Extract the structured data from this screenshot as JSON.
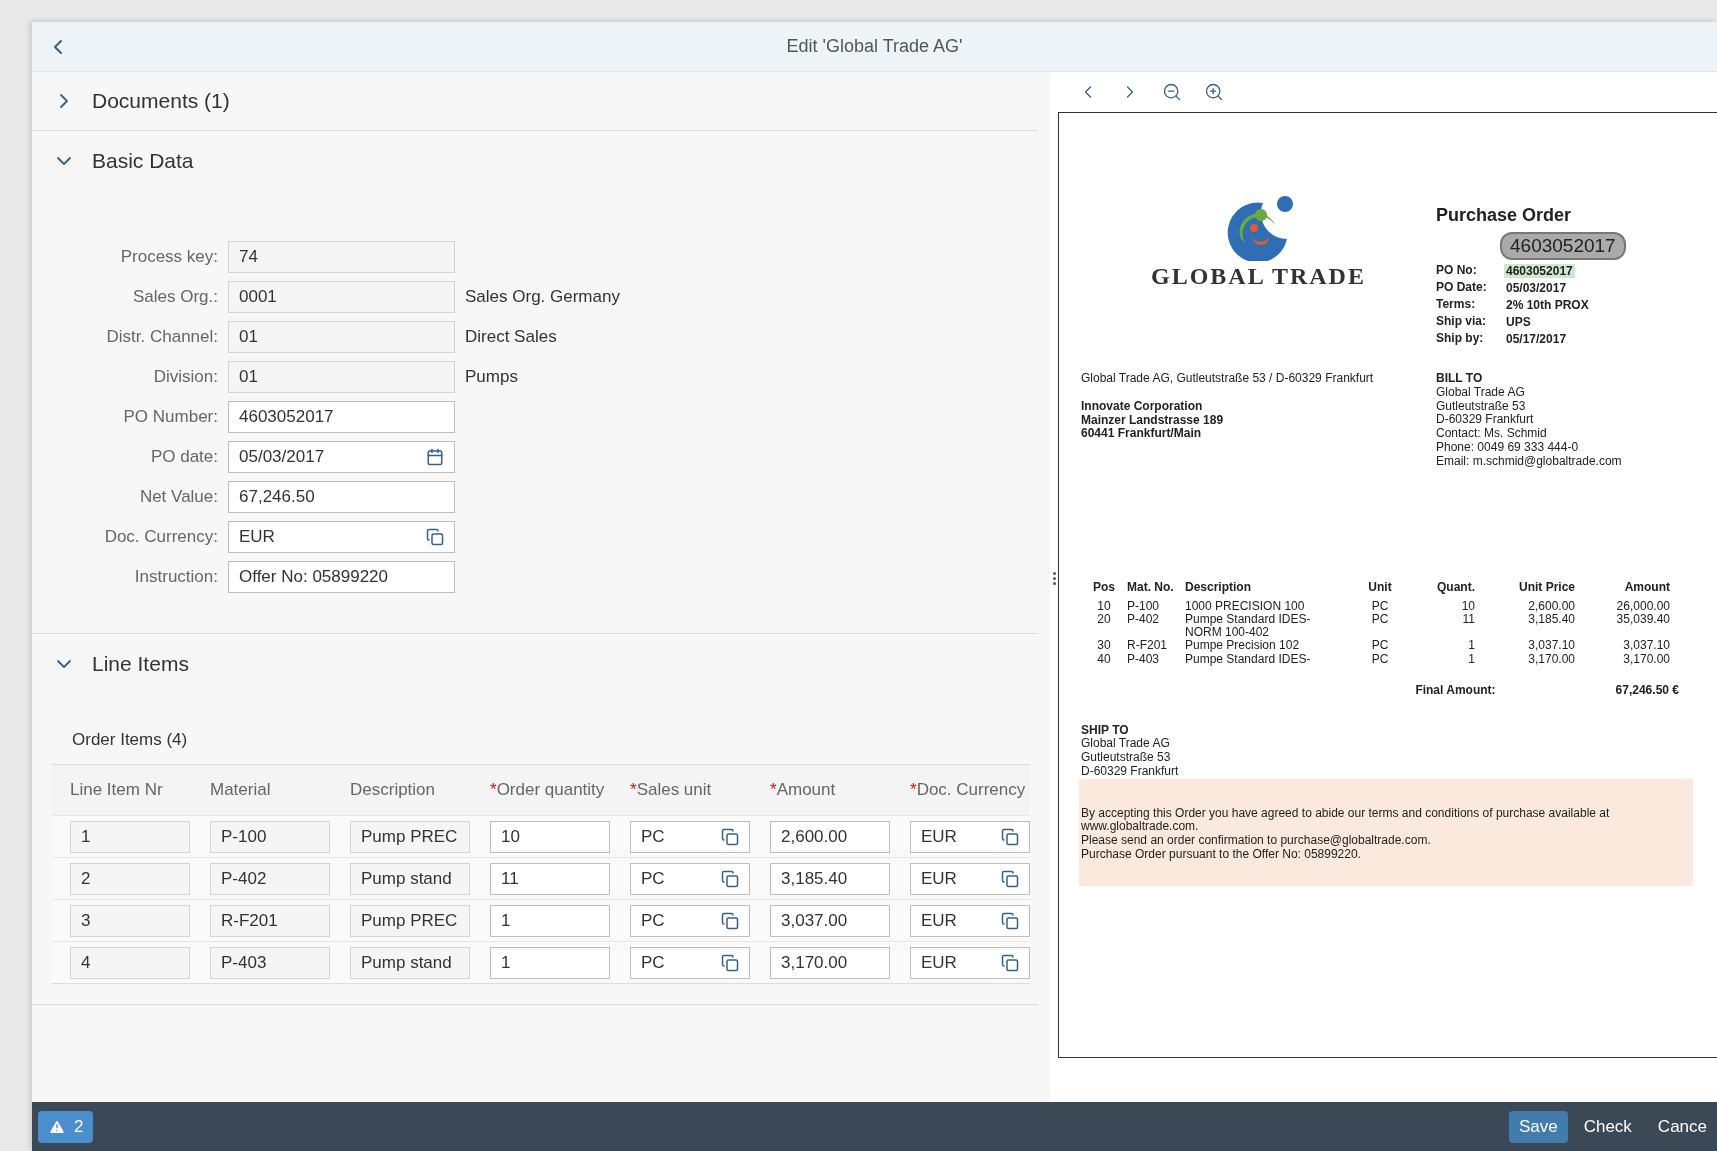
{
  "header": {
    "title": "Edit 'Global Trade AG'"
  },
  "sections": {
    "documents": {
      "title": "Documents (1)",
      "expanded": false
    },
    "basic": {
      "title": "Basic Data",
      "expanded": true
    },
    "items": {
      "title": "Line Items",
      "expanded": true
    }
  },
  "basic_data": [
    {
      "label": "Process key:",
      "value": "74",
      "editable": false,
      "kind": "text"
    },
    {
      "label": "Sales Org.:",
      "value": "0001",
      "editable": false,
      "kind": "text",
      "description": "Sales Org. Germany"
    },
    {
      "label": "Distr. Channel:",
      "value": "01",
      "editable": false,
      "kind": "text",
      "description": "Direct Sales"
    },
    {
      "label": "Division:",
      "value": "01",
      "editable": false,
      "kind": "text",
      "description": "Pumps"
    },
    {
      "label": "PO Number:",
      "value": "4603052017",
      "editable": true,
      "kind": "text"
    },
    {
      "label": "PO date:",
      "value": "05/03/2017",
      "editable": true,
      "kind": "date"
    },
    {
      "label": "Net Value:",
      "value": "67,246.50",
      "editable": true,
      "kind": "text"
    },
    {
      "label": "Doc. Currency:",
      "value": "EUR",
      "editable": true,
      "kind": "valuehelp"
    },
    {
      "label": "Instruction:",
      "value": "Offer No: 05899220",
      "editable": true,
      "kind": "text"
    }
  ],
  "order_items": {
    "title": "Order Items (4)",
    "required_mark": "*",
    "columns": [
      {
        "label": "Line Item Nr",
        "required": false
      },
      {
        "label": "Material",
        "required": false
      },
      {
        "label": "Description",
        "required": false
      },
      {
        "label": "Order quantity",
        "required": true
      },
      {
        "label": "Sales unit",
        "required": true
      },
      {
        "label": "Amount",
        "required": true
      },
      {
        "label": "Doc. Currency",
        "required": true
      }
    ],
    "rows": [
      {
        "cells": [
          "1",
          "P-100",
          "Pump PREC",
          "10",
          "PC",
          "2,600.00",
          "EUR"
        ]
      },
      {
        "cells": [
          "2",
          "P-402",
          "Pump stand",
          "11",
          "PC",
          "3,185.40",
          "EUR"
        ]
      },
      {
        "cells": [
          "3",
          "R-F201",
          "Pump PREC",
          "1",
          "PC",
          "3,037.00",
          "EUR"
        ]
      },
      {
        "cells": [
          "4",
          "P-403",
          "Pump stand",
          "1",
          "PC",
          "3,170.00",
          "EUR"
        ]
      }
    ]
  },
  "viewer": {
    "document": {
      "logo_text": "GLOBAL TRADE",
      "title": "Purchase Order",
      "highlight_bubble": "4603052017",
      "details": [
        {
          "label": "PO No:",
          "value": "4603052017",
          "highlighted": true
        },
        {
          "label": "PO Date:",
          "value": "05/03/2017",
          "highlighted": false
        },
        {
          "label": "Terms:",
          "value": "2% 10th PROX",
          "highlighted": false
        },
        {
          "label": "Ship via:",
          "value": "UPS",
          "highlighted": false
        },
        {
          "label": "Ship by:",
          "value": "05/17/2017",
          "highlighted": false
        }
      ],
      "sender_line": "Global Trade AG, Gutleutstraße 53 / D-60329 Frankfurt",
      "recipient": [
        "Innovate Corporation",
        "Mainzer Landstrasse 189",
        "60441 Frankfurt/Main"
      ],
      "bill_to_title": "BILL TO",
      "bill_to": [
        "Global Trade AG",
        "Gutleutstraße 53",
        "D-60329 Frankfurt",
        "Contact: Ms. Schmid",
        "Phone: 0049 69 333 444-0",
        "Email: m.schmid@globaltrade.com"
      ],
      "table_columns": [
        "Pos",
        "Mat. No.",
        "Description",
        "Unit",
        "Quant.",
        "Unit Price",
        "Amount"
      ],
      "table_rows": [
        [
          "10",
          "P-100",
          "1000 PRECISION 100",
          "PC",
          "10",
          "2,600.00",
          "26,000.00"
        ],
        [
          "20",
          "P-402",
          "Pumpe Standard IDES-\nNORM 100-402",
          "PC",
          "11",
          "3,185.40",
          "35,039.40"
        ],
        [
          "30",
          "R-F201",
          "Pumpe Precision 102",
          "PC",
          "1",
          "3,037.10",
          "3,037.10"
        ],
        [
          "40",
          "P-403",
          "Pumpe Standard IDES-",
          "PC",
          "1",
          "3,170.00",
          "3,170.00"
        ]
      ],
      "final_label": "Final Amount:",
      "final_value": "67,246.50 €",
      "ship_to_title": "SHIP TO",
      "ship_to": [
        "Global Trade AG",
        "Gutleutstraße 53",
        "D-60329 Frankfurt"
      ],
      "notes": [
        "By accepting this Order you have agreed to abide our terms and conditions of purchase available at www.globaltrade.com.",
        "Please send an order confirmation to purchase@globaltrade.com.",
        "Purchase Order pursuant to the Offer No: 05899220."
      ]
    }
  },
  "footer": {
    "messages": "2",
    "actions": [
      {
        "label": "Save",
        "emphasized": true
      },
      {
        "label": "Check",
        "emphasized": false
      },
      {
        "label": "Cance",
        "emphasized": false
      }
    ]
  }
}
